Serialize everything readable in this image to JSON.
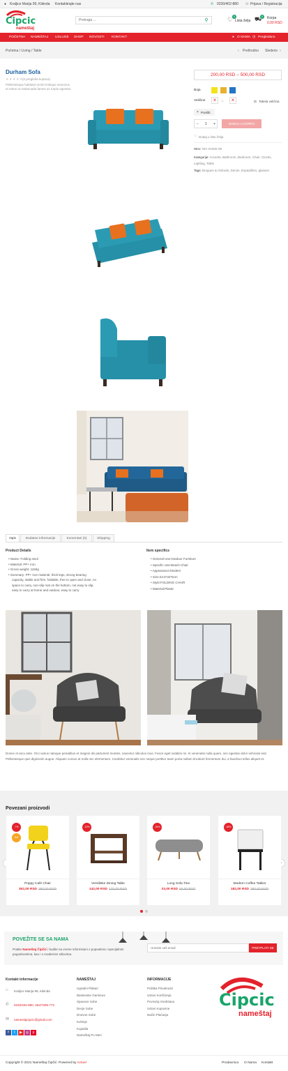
{
  "topbar": {
    "address": "Kraljice Marija 99, Kikinda",
    "contact_link": "Kontaktirajte nas",
    "phone": "0230/402-880",
    "login": "Prijava / Registracija"
  },
  "header": {
    "logo_top": "Cipcic",
    "logo_bottom": "nameštaj",
    "search_placeholder": "Pretraga ...",
    "wishlist_label": "Lista želja",
    "wishlist_count": "0",
    "cart_label": "Korpa",
    "cart_total": "0,00 RSD",
    "cart_count": "0"
  },
  "nav": {
    "items": [
      "POČETNA",
      "NAMEŠTAJ",
      "USLUGE",
      "SHOP",
      "NOVOSTI",
      "KONTAKT"
    ],
    "right_1": "O NAMA",
    "right_2": "Pregledano"
  },
  "breadcrumb": {
    "path": "Početna / Living / Table",
    "prev": "Prethodno",
    "next": "Sledeće"
  },
  "product": {
    "title": "Durham Sofa",
    "reviews": "(0 pregleda kupaca)",
    "description": "Pellentesque habitant morbi tristique senectus et netus et malesuada fames ac turpis egestas.",
    "price": "200,00 RSD – 500,00 RSD",
    "color_label": "Boja",
    "colors": [
      "#f2e31b",
      "#e8b22e",
      "#2475c4"
    ],
    "size_label": "Veličine",
    "size_guide": "Tabela veličina",
    "reset": "Poništi",
    "qty": "1",
    "add_to_cart": "DODAJ U KORPU",
    "wishlist": "Dodaj u listu želja",
    "sku_label": "SKU:",
    "sku": "N/A-SHGE-09",
    "cat_label": "Kategorije:",
    "categories": "Accents, Bathroom, Bedroom, Chair, Clocks, Lighting, Table",
    "tags_label": "Tags:",
    "tags": "Brogues & Oxfords, Denim, Espadrilles, glasses"
  },
  "tabs": [
    "Opis",
    "Dodatne informacije",
    "Komentari (0)",
    "Shipping"
  ],
  "details": {
    "left_title": "Product Details",
    "left_items": [
      "Name: Folding stool",
      "Material: PP+ iron",
      "Gross weight: 1160g",
      "Summary: PP+ iron material, thick legs, strong bearing",
      "capacity, stable and firm, foldable, free to open and close, no",
      "space to carry, non-slip mat on the bottom, not easy to slip,",
      "easy to carry at home and outdoor, easy to carry"
    ],
    "right_title": "Item specifics",
    "right_items": [
      "General Use:Outdoor Furniture",
      "Specific Use:Beach Chair",
      "Appearance:Modern",
      "Size:23.5*32*5cm",
      "Style:FOLDING CHAIR",
      "Material:Plastic"
    ]
  },
  "long_text": "Donec et arcu ante. Orci varius natoque penatibus et magnis dis parturient montes, nascetur ridiculus mus. Fusce eget sodales mi. In venenatis nulla quam, nec egestas dolor vehicula sed. Pellentesque quis dignissim augue. Aliquam cursus at nulla nec elementum. Curabitur venenatis nec neque porttitor team porta nullam tincidunt fermentum dui, a faucibus tellus aliquet et.",
  "related": {
    "title": "Povezani proizvodi",
    "items": [
      {
        "name": "Poppy Café Chair",
        "price": "352,00 RSD",
        "old": "380,00 RSD",
        "badge": "-7%",
        "badge2": "Hot"
      },
      {
        "name": "Versiliske Dining Table",
        "price": "142,00 RSD",
        "old": "175,00 RSD",
        "badge": "-19%",
        "badge2": ""
      },
      {
        "name": "Long Sofa Tine",
        "price": "33,00 RSD",
        "old": "50,00 RSD",
        "badge": "-34%",
        "badge2": ""
      },
      {
        "name": "Modern Coffee Tables",
        "price": "182,00 RSD",
        "old": "350,00 RSD",
        "badge": "-48%",
        "badge2": ""
      }
    ]
  },
  "newsletter": {
    "title": "POVEŽITE SE SA NAMA",
    "text_prefix": "Pratite ",
    "text_brand": "Nameštaj Čipčić",
    "text_rest": " i budite na vreme informisani o popustima i specijalnim pogodnostima, kao i o modernim stilovima.",
    "placeholder": "Unesite vaš email",
    "button": "PRETPLATI SE"
  },
  "footer": {
    "contact_title": "Kontakt informacije",
    "address": "Kraljice Marija 99, Kikinda",
    "phones": "0230/402-880, 064/7285-772",
    "email": "namestajcipcic@gmail.com",
    "col2_title": "NAMEŠTAJ",
    "col2_items": [
      "Ugradni Plakari",
      "Bastenske Garniture",
      "Spavace Sobe",
      "Decje Sobe",
      "Dnevne Sobe",
      "Kuhinje",
      "Kupatila",
      "Nameštaj Po Meri"
    ],
    "col3_title": "INFORMACIJE",
    "col3_items": [
      "Politika Privatnosti",
      "Uslovi Korišćenja",
      "Povraćaj Sredstava",
      "Uslovi Kupovine",
      "Način Plaćanja"
    ],
    "copyright_prefix": "Copyright © 2021 Nameštaj Čipčić. Powered by ",
    "powered": "Actuel",
    "links": [
      "Prodavnica",
      "O Nama",
      "Kontakt"
    ]
  }
}
